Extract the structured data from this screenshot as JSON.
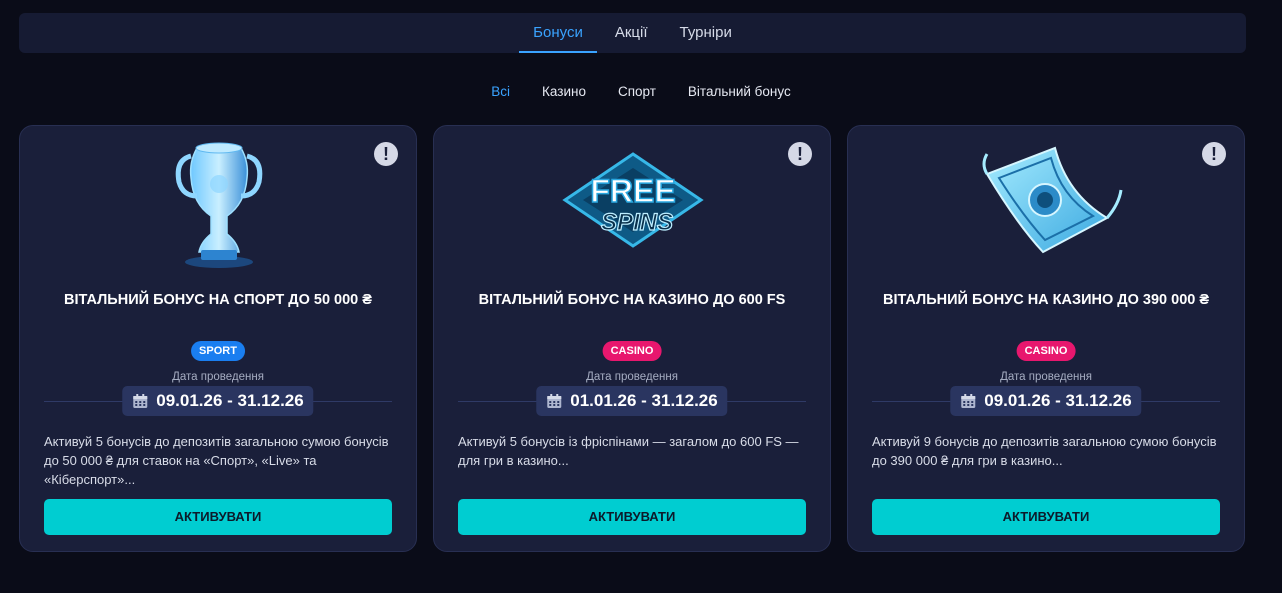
{
  "tabs": [
    {
      "label": "Бонуси",
      "active": true
    },
    {
      "label": "Акції",
      "active": false
    },
    {
      "label": "Турніри",
      "active": false
    }
  ],
  "filters": [
    {
      "label": "Всі",
      "active": true
    },
    {
      "label": "Казино",
      "active": false
    },
    {
      "label": "Спорт",
      "active": false
    },
    {
      "label": "Вітальний бонус",
      "active": false
    }
  ],
  "colors": {
    "accent": "#3aa3ff",
    "button": "#00cdd1",
    "sport_tag": "#1a7ef0",
    "casino_tag": "#e8176e"
  },
  "cards": [
    {
      "art_icon": "trophy-icon",
      "title": "ВІТАЛЬНИЙ БОНУС НА СПОРТ ДО 50 000 ₴",
      "tag": "SPORT",
      "date_label": "Дата проведення",
      "dates": "09.01.26 - 31.12.26",
      "description": "Активуй 5 бонусів до депозитів загальною сумою бонусів до 50 000 ₴ для ставок на «Спорт», «Live» та «Кіберспорт»...",
      "button": "АКТИВУВАТИ"
    },
    {
      "art_icon": "free-spins-icon",
      "art_text_top": "FREE",
      "art_text_bottom": "SPINS",
      "title": "ВІТАЛЬНИЙ БОНУС НА КАЗИНО ДО 600 FS",
      "tag": "CASINO",
      "date_label": "Дата проведення",
      "dates": "01.01.26 - 31.12.26",
      "description": "Активуй 5 бонусів із фріспінами — загалом до 600 FS — для гри в казино...",
      "button": "АКТИВУВАТИ"
    },
    {
      "art_icon": "banknote-icon",
      "title": "ВІТАЛЬНИЙ БОНУС НА КАЗИНО ДО 390 000 ₴",
      "tag": "CASINO",
      "date_label": "Дата проведення",
      "dates": "09.01.26 - 31.12.26",
      "description": "Активуй 9 бонусів до депозитів загальною сумою бонусів до 390 000 ₴ для гри в казино...",
      "button": "АКТИВУВАТИ"
    }
  ]
}
